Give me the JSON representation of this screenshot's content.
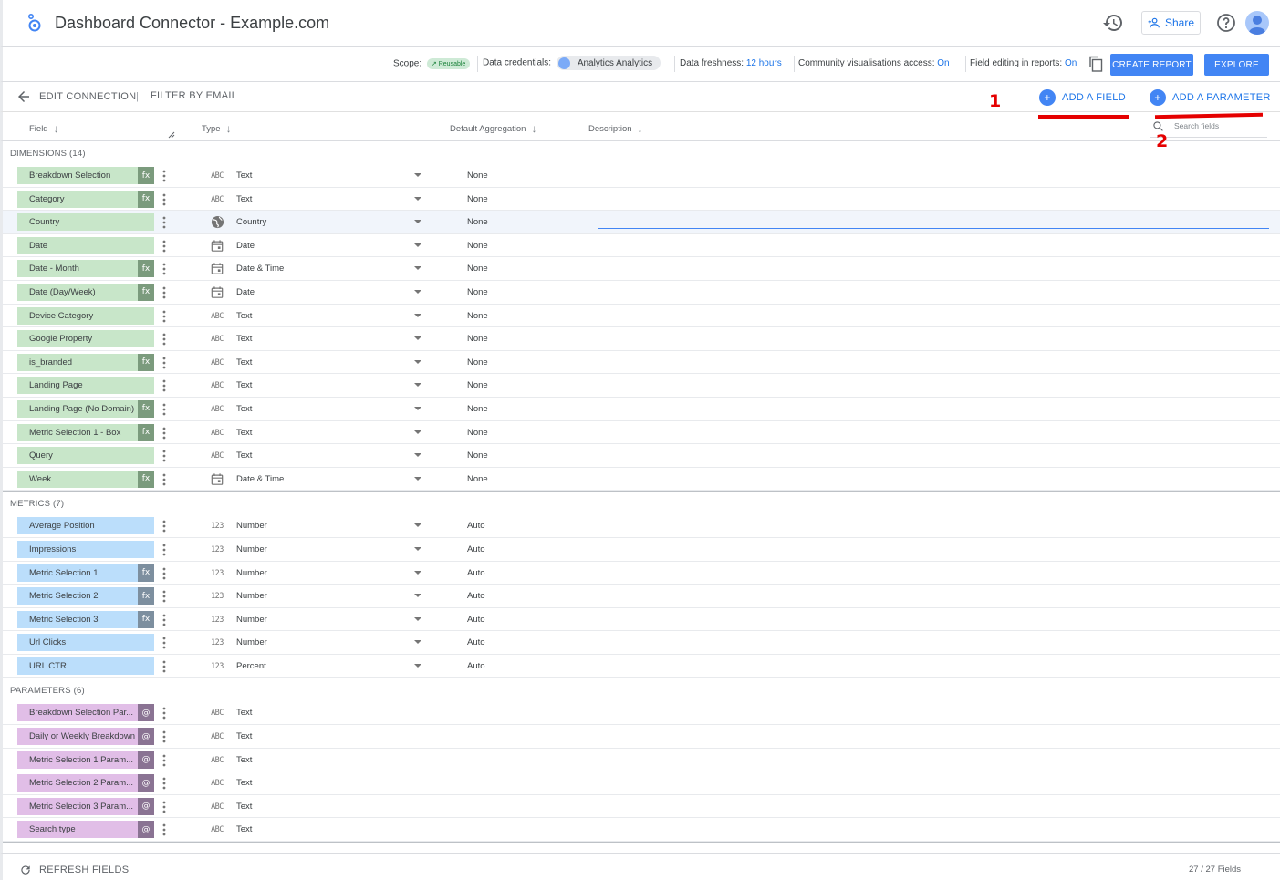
{
  "header": {
    "title": "Dashboard Connector - Example.com",
    "share_label": "Share",
    "icons": [
      "looker-studio-logo-icon",
      "history-icon",
      "add-person-icon",
      "help-icon",
      "avatar-icon"
    ]
  },
  "toolbar": {
    "scope_label": "Scope:",
    "scope_value": "Reusable",
    "credentials_label": "Data credentials:",
    "credentials_value": "Analytics Analytics",
    "freshness_label": "Data freshness:",
    "freshness_value": "12 hours",
    "community_label": "Community visualisations access:",
    "community_value": "On",
    "field_editing_label": "Field editing in reports:",
    "field_editing_value": "On",
    "create_report_label": "CREATE REPORT",
    "explore_label": "EXPLORE"
  },
  "subbar": {
    "edit_connection_label": "EDIT CONNECTION",
    "separator": "|",
    "filter_by_email_label": "FILTER BY EMAIL",
    "add_field_label": "ADD A FIELD",
    "add_parameter_label": "ADD A PARAMETER",
    "annotation_1": "1",
    "annotation_2": "2"
  },
  "columns": {
    "field": "Field",
    "type": "Type",
    "default_aggregation": "Default Aggregation",
    "description": "Description",
    "search_placeholder": "Search fields"
  },
  "dimensions": {
    "label": "DIMENSIONS (14)",
    "rows": [
      {
        "name": "Breakdown Selection",
        "fx": "fx",
        "type_icon": "ABC",
        "type": "Text",
        "agg": "None"
      },
      {
        "name": "Category",
        "fx": "fx",
        "type_icon": "ABC",
        "type": "Text",
        "agg": "None"
      },
      {
        "name": "Country",
        "fx": "",
        "type_icon": "globe",
        "type": "Country",
        "agg": "None"
      },
      {
        "name": "Date",
        "fx": "",
        "type_icon": "calendar",
        "type": "Date",
        "agg": "None"
      },
      {
        "name": "Date - Month",
        "fx": "fx",
        "type_icon": "calendar",
        "type": "Date & Time",
        "agg": "None"
      },
      {
        "name": "Date (Day/Week)",
        "fx": "fx",
        "type_icon": "calendar",
        "type": "Date",
        "agg": "None"
      },
      {
        "name": "Device Category",
        "fx": "",
        "type_icon": "ABC",
        "type": "Text",
        "agg": "None"
      },
      {
        "name": "Google Property",
        "fx": "",
        "type_icon": "ABC",
        "type": "Text",
        "agg": "None"
      },
      {
        "name": "is_branded",
        "fx": "fx",
        "type_icon": "ABC",
        "type": "Text",
        "agg": "None"
      },
      {
        "name": "Landing Page",
        "fx": "",
        "type_icon": "ABC",
        "type": "Text",
        "agg": "None"
      },
      {
        "name": "Landing Page (No Domain)",
        "fx": "fx",
        "type_icon": "ABC",
        "type": "Text",
        "agg": "None"
      },
      {
        "name": "Metric Selection 1 - Box",
        "fx": "fx",
        "type_icon": "ABC",
        "type": "Text",
        "agg": "None"
      },
      {
        "name": "Query",
        "fx": "",
        "type_icon": "ABC",
        "type": "Text",
        "agg": "None"
      },
      {
        "name": "Week",
        "fx": "fx",
        "type_icon": "calendar",
        "type": "Date & Time",
        "agg": "None"
      }
    ]
  },
  "metrics": {
    "label": "METRICS (7)",
    "rows": [
      {
        "name": "Average Position",
        "fx": "",
        "type_icon": "123",
        "type": "Number",
        "agg": "Auto"
      },
      {
        "name": "Impressions",
        "fx": "",
        "type_icon": "123",
        "type": "Number",
        "agg": "Auto"
      },
      {
        "name": "Metric Selection 1",
        "fx": "fx",
        "type_icon": "123",
        "type": "Number",
        "agg": "Auto"
      },
      {
        "name": "Metric Selection 2",
        "fx": "fx",
        "type_icon": "123",
        "type": "Number",
        "agg": "Auto"
      },
      {
        "name": "Metric Selection 3",
        "fx": "fx",
        "type_icon": "123",
        "type": "Number",
        "agg": "Auto"
      },
      {
        "name": "Url Clicks",
        "fx": "",
        "type_icon": "123",
        "type": "Number",
        "agg": "Auto"
      },
      {
        "name": "URL CTR",
        "fx": "",
        "type_icon": "123",
        "type": "Percent",
        "agg": "Auto"
      }
    ]
  },
  "parameters": {
    "label": "PARAMETERS (6)",
    "rows": [
      {
        "name": "Breakdown Selection Par...",
        "fx": "@",
        "type_icon": "ABC",
        "type": "Text"
      },
      {
        "name": "Daily or Weekly Breakdown",
        "fx": "@",
        "type_icon": "ABC",
        "type": "Text"
      },
      {
        "name": "Metric Selection 1 Param...",
        "fx": "@",
        "type_icon": "ABC",
        "type": "Text"
      },
      {
        "name": "Metric Selection 2 Param...",
        "fx": "@",
        "type_icon": "ABC",
        "type": "Text"
      },
      {
        "name": "Metric Selection 3 Param...",
        "fx": "@",
        "type_icon": "ABC",
        "type": "Text"
      },
      {
        "name": "Search type",
        "fx": "@",
        "type_icon": "ABC",
        "type": "Text"
      }
    ]
  },
  "footer": {
    "refresh_label": "REFRESH FIELDS",
    "field_count": "27 / 27 Fields"
  },
  "colors": {
    "accent": "#4285f4",
    "link": "#1a73e8",
    "dimension": "#c8e6c9",
    "metric": "#bbdefb",
    "parameter": "#e1bee7",
    "annotation": "#e50000"
  }
}
